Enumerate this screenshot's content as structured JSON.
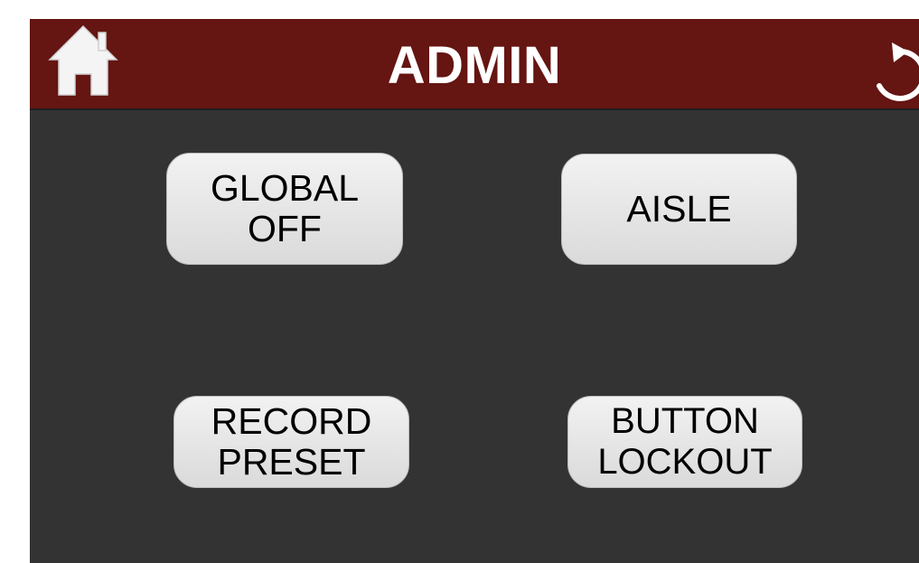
{
  "header": {
    "title": "ADMIN",
    "home_icon": "home-icon",
    "back_icon": "back-arrow-icon",
    "background_color": "#651512"
  },
  "tiles": {
    "global_off": {
      "line1": "GLOBAL",
      "line2": "OFF"
    },
    "aisle": {
      "label": "AISLE"
    },
    "record_preset": {
      "line1": "RECORD",
      "line2": "PRESET"
    },
    "button_lockout": {
      "line1": "BUTTON",
      "line2": "LOCKOUT"
    }
  },
  "colors": {
    "screen_background": "#333333",
    "tile_background": "#e6e6e6",
    "title_text": "#ffffff"
  }
}
